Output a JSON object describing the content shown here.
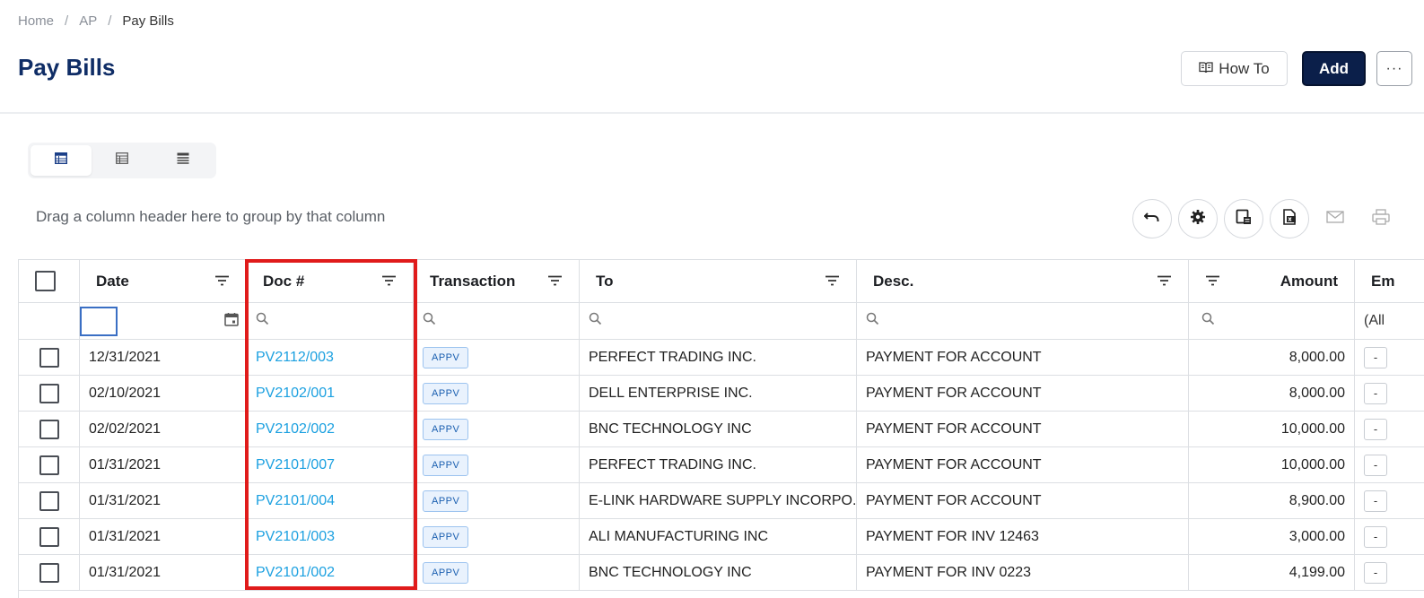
{
  "breadcrumb": {
    "home": "Home",
    "sep1": "/",
    "ap": "AP",
    "sep2": "/",
    "current": "Pay Bills"
  },
  "page": {
    "title": "Pay Bills"
  },
  "actions": {
    "howto_label": "How To",
    "add_label": "Add",
    "more_label": "···"
  },
  "views": {
    "icons": [
      "grid-view-icon",
      "table-view-icon",
      "list-view-icon"
    ],
    "active_index": 0
  },
  "grid_toolbar": {
    "group_hint": "Drag a column header here to group by that column",
    "icons": [
      "undo-icon",
      "gear-icon",
      "column-chooser-icon",
      "export-excel-icon",
      "mail-icon",
      "print-icon"
    ]
  },
  "table": {
    "columns": {
      "date": "Date",
      "doc": "Doc #",
      "transaction": "Transaction",
      "to": "To",
      "desc": "Desc.",
      "amount": "Amount",
      "em": "Em"
    },
    "filter_em_placeholder": "(All",
    "rows": [
      {
        "date": "12/31/2021",
        "doc": "PV2112/003",
        "status": "APPV",
        "to": "PERFECT TRADING INC.",
        "desc": "PAYMENT FOR ACCOUNT",
        "amount": "8,000.00",
        "em": "-"
      },
      {
        "date": "02/10/2021",
        "doc": "PV2102/001",
        "status": "APPV",
        "to": "DELL ENTERPRISE INC.",
        "desc": "PAYMENT FOR ACCOUNT",
        "amount": "8,000.00",
        "em": "-"
      },
      {
        "date": "02/02/2021",
        "doc": "PV2102/002",
        "status": "APPV",
        "to": "BNC TECHNOLOGY INC",
        "desc": "PAYMENT FOR ACCOUNT",
        "amount": "10,000.00",
        "em": "-"
      },
      {
        "date": "01/31/2021",
        "doc": "PV2101/007",
        "status": "APPV",
        "to": "PERFECT TRADING INC.",
        "desc": "PAYMENT FOR ACCOUNT",
        "amount": "10,000.00",
        "em": "-"
      },
      {
        "date": "01/31/2021",
        "doc": "PV2101/004",
        "status": "APPV",
        "to": "E-LINK HARDWARE SUPPLY INCORPO...",
        "desc": "PAYMENT FOR ACCOUNT",
        "amount": "8,900.00",
        "em": "-"
      },
      {
        "date": "01/31/2021",
        "doc": "PV2101/003",
        "status": "APPV",
        "to": "ALI MANUFACTURING INC",
        "desc": "PAYMENT FOR INV 12463",
        "amount": "3,000.00",
        "em": "-"
      },
      {
        "date": "01/31/2021",
        "doc": "PV2101/002",
        "status": "APPV",
        "to": "BNC TECHNOLOGY INC",
        "desc": "PAYMENT FOR INV 0223",
        "amount": "4,199.00",
        "em": "-"
      }
    ]
  },
  "colors": {
    "title": "#0f2d66",
    "add_button": "#0b1f4a",
    "link": "#1ba0e0",
    "highlight": "#e01b1b"
  }
}
